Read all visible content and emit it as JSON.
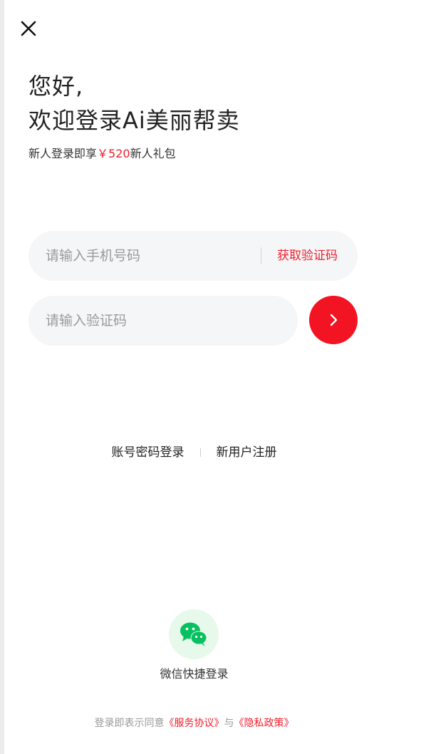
{
  "header": {
    "close_icon": "close-icon"
  },
  "title": {
    "greeting": "您好,",
    "welcome": "欢迎登录Ai美丽帮卖"
  },
  "promo": {
    "prefix": "新人登录即享",
    "amount": "￥520",
    "suffix": "新人礼包"
  },
  "form": {
    "phone_placeholder": "请输入手机号码",
    "get_code_label": "获取验证码",
    "code_placeholder": "请输入验证码",
    "submit_icon": "chevron-right-icon"
  },
  "alt_login": {
    "password_login": "账号密码登录",
    "register": "新用户注册"
  },
  "wechat": {
    "icon": "wechat-icon",
    "label": "微信快捷登录"
  },
  "agreement": {
    "prefix": "登录即表示同意",
    "service": "《服务协议》",
    "connector": "与",
    "privacy": "《隐私政策》"
  },
  "colors": {
    "accent": "#f01e2c",
    "input_bg": "#f5f6f8",
    "wechat_green": "#07c160",
    "wechat_bg": "#e7f9ea"
  }
}
